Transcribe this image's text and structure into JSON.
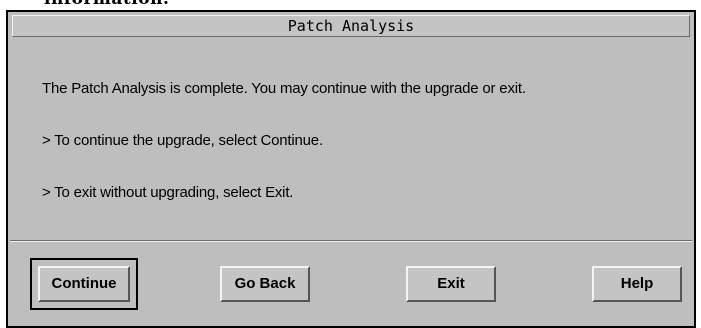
{
  "background_cut_text": "information.",
  "dialog": {
    "title": "Patch Analysis",
    "messages": [
      "The Patch Analysis is complete.  You may continue with the upgrade or exit.",
      "> To continue the upgrade, select Continue.",
      "> To exit without upgrading, select Exit."
    ],
    "buttons": {
      "continue": "Continue",
      "go_back": "Go Back",
      "exit": "Exit",
      "help": "Help"
    }
  },
  "colors": {
    "dialog_background": "#bebebe",
    "button_face": "#c4c4c4"
  }
}
